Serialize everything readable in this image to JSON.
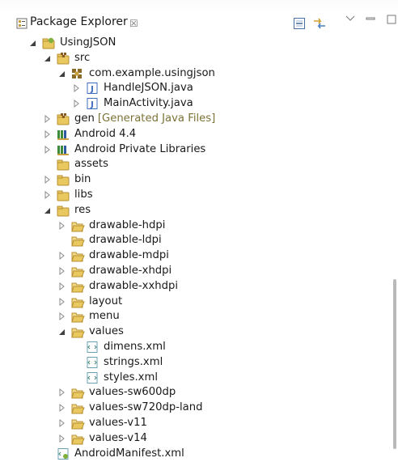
{
  "view": {
    "title": "Package Explorer",
    "close_glyph": "☒",
    "toolbar": [
      "collapse-all-icon",
      "link-with-editor-icon",
      "view-menu-icon",
      "minimize-icon",
      "maximize-icon"
    ]
  },
  "tree": [
    {
      "label": "UsingJSON",
      "icon": "android-project-icon",
      "twisty": "expanded",
      "level": 0
    },
    {
      "label": "src",
      "icon": "source-folder-icon",
      "twisty": "expanded",
      "level": 1
    },
    {
      "label": "com.example.usingjson",
      "icon": "package-icon",
      "twisty": "expanded",
      "level": 2
    },
    {
      "label": "HandleJSON.java",
      "icon": "java-file-icon",
      "twisty": "collapsed",
      "level": 3
    },
    {
      "label": "MainActivity.java",
      "icon": "java-file-icon",
      "twisty": "collapsed",
      "level": 3
    },
    {
      "label": "gen",
      "extra": "[Generated Java Files]",
      "icon": "source-folder-icon",
      "twisty": "collapsed",
      "level": 1
    },
    {
      "label": "Android 4.4",
      "icon": "library-icon",
      "twisty": "collapsed",
      "level": 1
    },
    {
      "label": "Android Private Libraries",
      "icon": "library-icon",
      "twisty": "collapsed",
      "level": 1
    },
    {
      "label": "assets",
      "icon": "folder-icon",
      "twisty": "none",
      "level": 1
    },
    {
      "label": "bin",
      "icon": "folder-icon",
      "twisty": "collapsed",
      "level": 1
    },
    {
      "label": "libs",
      "icon": "folder-icon",
      "twisty": "collapsed",
      "level": 1
    },
    {
      "label": "res",
      "icon": "folder-icon",
      "twisty": "expanded",
      "level": 1
    },
    {
      "label": "drawable-hdpi",
      "icon": "open-folder-icon",
      "twisty": "collapsed",
      "level": 2
    },
    {
      "label": "drawable-ldpi",
      "icon": "open-folder-icon",
      "twisty": "none",
      "level": 2
    },
    {
      "label": "drawable-mdpi",
      "icon": "open-folder-icon",
      "twisty": "collapsed",
      "level": 2
    },
    {
      "label": "drawable-xhdpi",
      "icon": "open-folder-icon",
      "twisty": "collapsed",
      "level": 2
    },
    {
      "label": "drawable-xxhdpi",
      "icon": "open-folder-icon",
      "twisty": "collapsed",
      "level": 2
    },
    {
      "label": "layout",
      "icon": "open-folder-icon",
      "twisty": "collapsed",
      "level": 2
    },
    {
      "label": "menu",
      "icon": "open-folder-icon",
      "twisty": "collapsed",
      "level": 2
    },
    {
      "label": "values",
      "icon": "open-folder-icon",
      "twisty": "expanded",
      "level": 2
    },
    {
      "label": "dimens.xml",
      "icon": "xml-file-icon",
      "twisty": "none",
      "level": 3
    },
    {
      "label": "strings.xml",
      "icon": "xml-file-icon",
      "twisty": "none",
      "level": 3
    },
    {
      "label": "styles.xml",
      "icon": "xml-file-icon",
      "twisty": "none",
      "level": 3
    },
    {
      "label": "values-sw600dp",
      "icon": "open-folder-icon",
      "twisty": "collapsed",
      "level": 2
    },
    {
      "label": "values-sw720dp-land",
      "icon": "open-folder-icon",
      "twisty": "collapsed",
      "level": 2
    },
    {
      "label": "values-v11",
      "icon": "open-folder-icon",
      "twisty": "collapsed",
      "level": 2
    },
    {
      "label": "values-v14",
      "icon": "open-folder-icon",
      "twisty": "collapsed",
      "level": 2
    },
    {
      "label": "AndroidManifest.xml",
      "icon": "manifest-file-icon",
      "twisty": "none",
      "level": 1
    }
  ],
  "colors": {
    "folder": "#e9c860",
    "folder_dark": "#b89030",
    "java": "#3c6cc0",
    "package": "#8a6a26",
    "android": "#7fb03c",
    "text": "#1a1a1a",
    "decoration": "#7a7236"
  }
}
